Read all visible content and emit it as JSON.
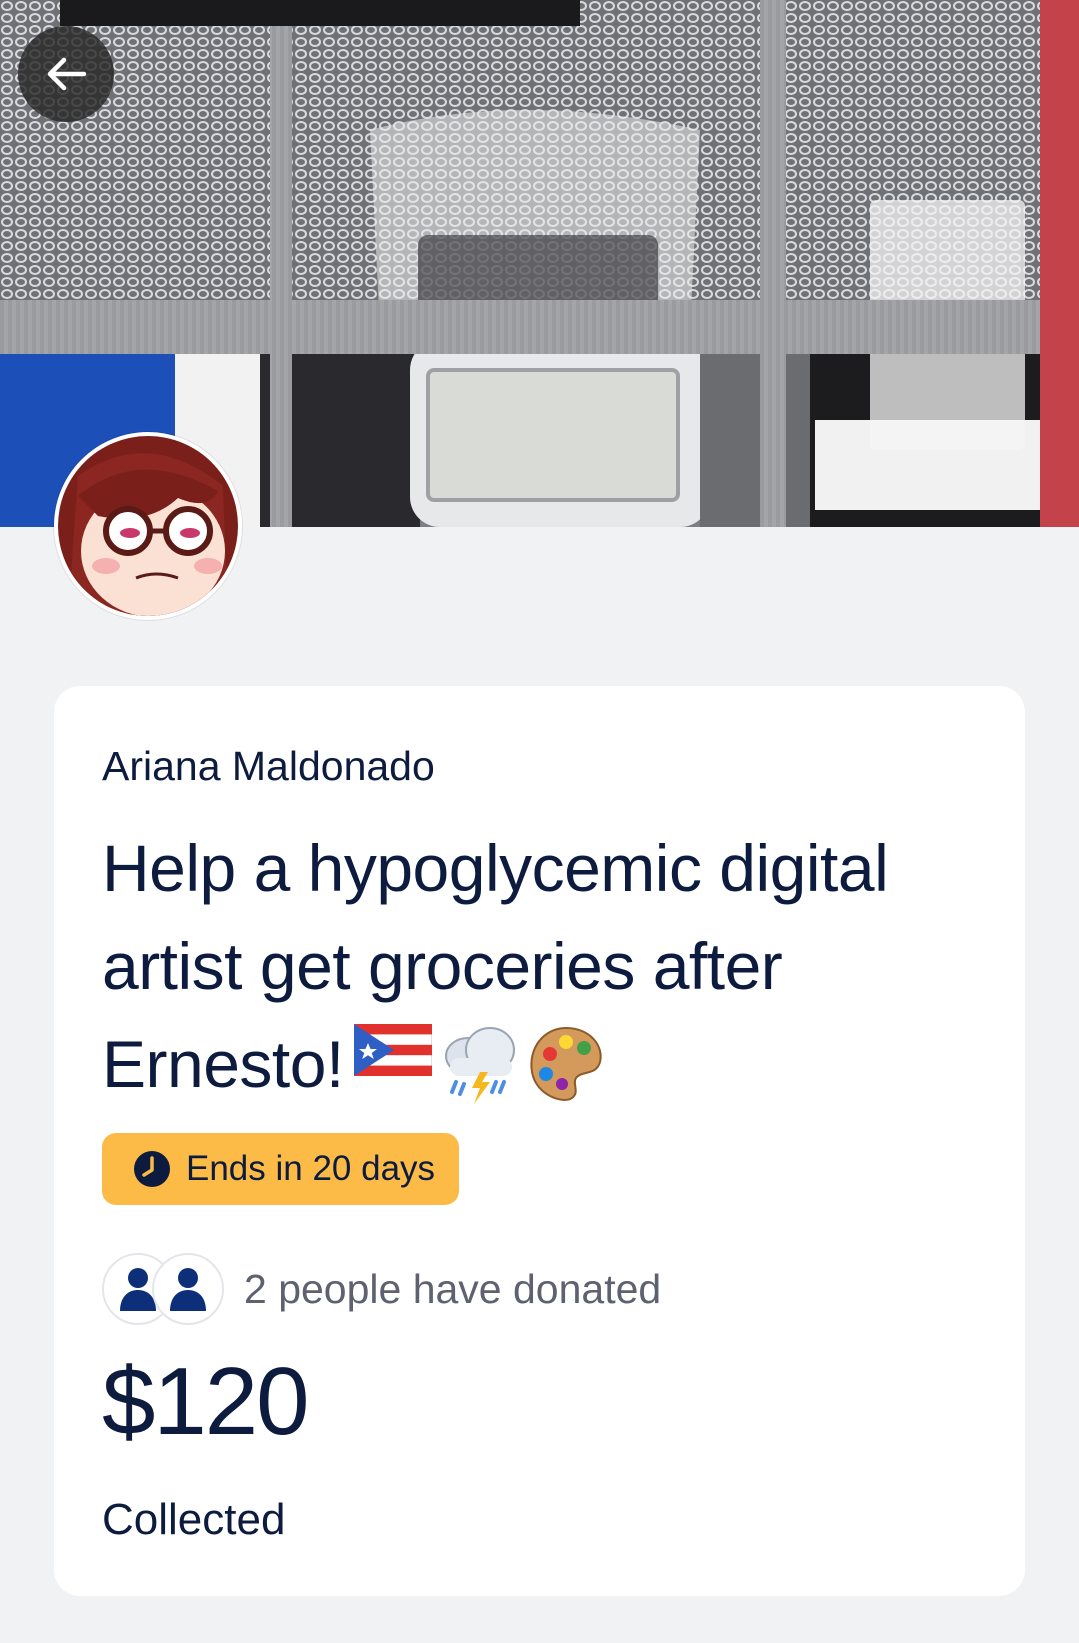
{
  "header": {
    "back_icon": "arrow-left-icon",
    "cover_image": "photo of glucose meter case with test strips"
  },
  "campaign": {
    "organizer_name": "Ariana Maldonado",
    "title": "Help a hypoglycemic digital artist get groceries after Ernesto!",
    "title_emojis": [
      "puerto-rico-flag-icon",
      "storm-cloud-icon",
      "artist-palette-icon"
    ],
    "ends_label": "Ends in 20 days",
    "ends_icon": "clock-icon",
    "donors_label": "2 people have donated",
    "donor_icon": "person-icon",
    "amount": "$120",
    "amount_label": "Collected"
  },
  "colors": {
    "background": "#f1f2f4",
    "card": "#ffffff",
    "text": "#0d1b3e",
    "badge": "#fcbb46",
    "donor_icon": "#0d2f7a"
  }
}
